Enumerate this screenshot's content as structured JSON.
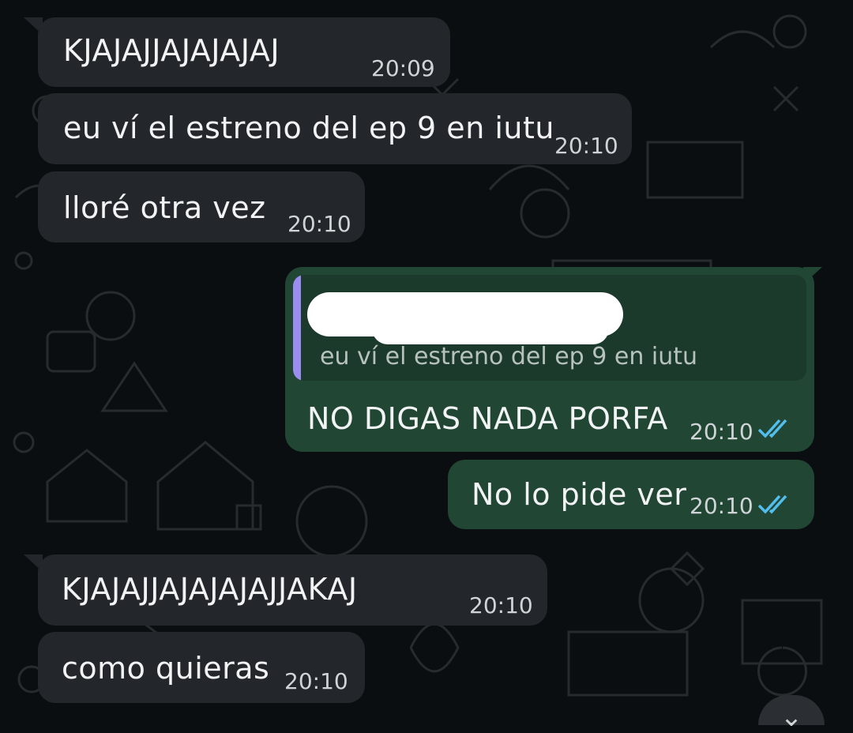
{
  "messages": [
    {
      "direction": "incoming",
      "text": "KJAJAJJAJAJAJAJ",
      "time": "20:09"
    },
    {
      "direction": "incoming",
      "text": "eu ví el estreno del ep 9 en iutu",
      "time": "20:10"
    },
    {
      "direction": "incoming",
      "text": "lloré otra vez",
      "time": "20:10"
    },
    {
      "direction": "outgoing",
      "quoted_text": "eu ví el estreno del ep 9 en iutu",
      "text": "NO DIGAS NADA PORFA",
      "time": "20:10",
      "status": "read"
    },
    {
      "direction": "outgoing",
      "text": "No lo pide ver",
      "time": "20:10",
      "status": "read"
    },
    {
      "direction": "incoming",
      "text": "KJAJAJJAJAJAJAJJAKAJ",
      "time": "20:10"
    },
    {
      "direction": "incoming",
      "text": "como quieras",
      "time": "20:10"
    }
  ],
  "colors": {
    "background": "#0b0e10",
    "incoming_bubble": "#23272b",
    "outgoing_bubble": "#214634",
    "quote_bar": "#9b8cf0",
    "read_ticks": "#53bdeb"
  },
  "icons": {
    "read_receipt": "double-check-icon",
    "scroll_down": "chevron-down-icon"
  }
}
